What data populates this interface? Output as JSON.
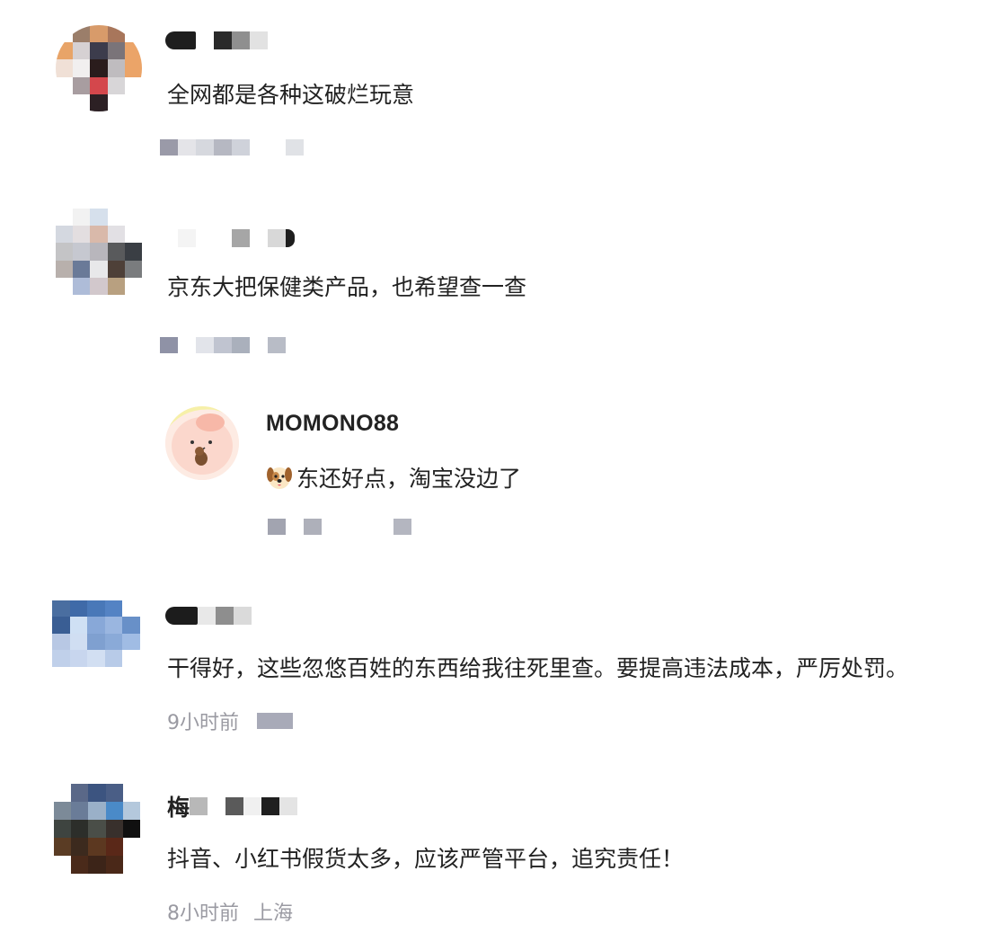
{
  "comments": [
    {
      "text": "全网都是各种这破烂玩意",
      "avatar_colors": [
        "#ffffff",
        "#9b7e6a",
        "#d89b6a",
        "#a8765b",
        "#ffffff",
        "#e8a468",
        "#d6d1d3",
        "#3c3c4c",
        "#7a7479",
        "#eba468",
        "#f0e0d6",
        "#f1efef",
        "#2a1c1c",
        "#bfbcbf",
        "#eba468",
        "#ffffff",
        "#a89da0",
        "#d4474c",
        "#d8d6d8",
        "#ffffff",
        "#ffffff",
        "#ffffff",
        "#2c2024",
        "#ffffff",
        "#ffffff"
      ]
    },
    {
      "text": "京东大把保健类产品，也希望查一查",
      "avatar_colors": [
        "#ffffff",
        "#f2f2f2",
        "#d6e0ec",
        "#ffffff",
        "#ffffff",
        "#d4d8e0",
        "#e3dee0",
        "#d9b9aa",
        "#e2e0e4",
        "#ffffff",
        "#c4c4c6",
        "#c6c8d0",
        "#b8b6bc",
        "#595a5c",
        "#3a3e44",
        "#b8b0ac",
        "#6a7a98",
        "#e8e8ea",
        "#4e4038",
        "#7a7c7e",
        "#ffffff",
        "#aebcd8",
        "#d2c8cc",
        "#b8a080",
        "#ffffff"
      ]
    },
    {
      "is_reply": true,
      "username": "MOMONO88",
      "text": "东还好点，淘宝没边了",
      "emoji_icon": "dog-face-icon"
    },
    {
      "text": "干得好，这些忽悠百姓的东西给我往死里查。要提高违法成本，严厉处罚。",
      "time": "9小时前",
      "avatar_colors": [
        "#4a6ea0",
        "#3f6aa8",
        "#4978b8",
        "#5483c4",
        "#ffffff",
        "#3a5e94",
        "#cfe0f4",
        "#88a8d8",
        "#9ab6e0",
        "#6890c8",
        "#b8c8e4",
        "#d0def2",
        "#7fa0d0",
        "#8aaad8",
        "#a0bce4",
        "#c0d0ea",
        "#c8d6ee",
        "#d2dff2",
        "#b8cbe8",
        "#ffffff",
        "#ffffff",
        "#ffffff",
        "#ffffff",
        "#ffffff",
        "#ffffff"
      ]
    },
    {
      "username_prefix": "梅",
      "text": "抖音、小红书假货太多，应该严管平台，追究责任！",
      "time": "8小时前",
      "location": "上海",
      "avatar_colors": [
        "#ffffff",
        "#5a6888",
        "#3c5480",
        "#4a5e86",
        "#ffffff",
        "#7c8a98",
        "#6a7c98",
        "#9ab0c8",
        "#4a8ac8",
        "#b4c8dc",
        "#3e4440",
        "#2c2e2a",
        "#4a4e48",
        "#38302c",
        "#101010",
        "#5a3c24",
        "#3c2a1e",
        "#5c3820",
        "#5a2818",
        "#ffffff",
        "#ffffff",
        "#4a2a1a",
        "#3c2418",
        "#4a2818",
        "#ffffff"
      ]
    }
  ]
}
